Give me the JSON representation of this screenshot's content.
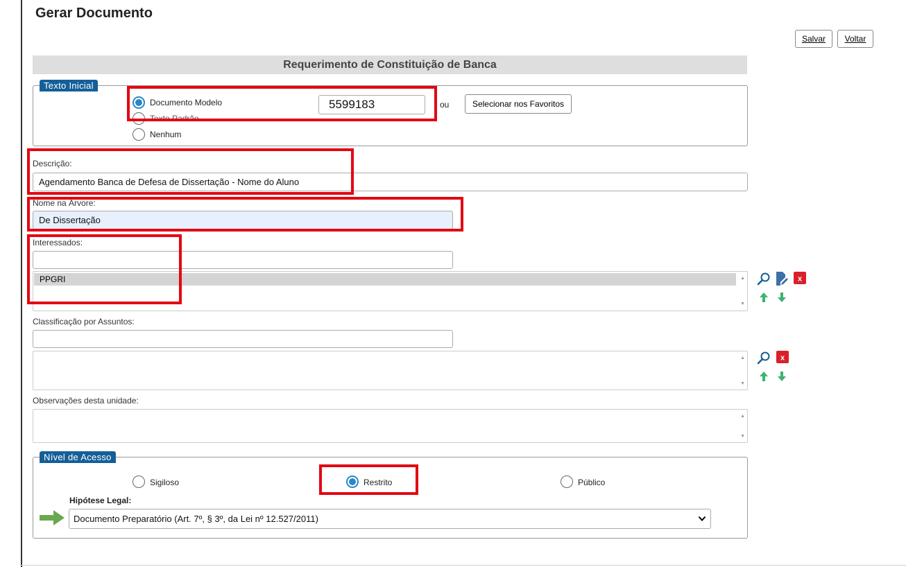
{
  "page": {
    "title": "Gerar Documento"
  },
  "toolbar": {
    "save_label": "Salvar",
    "back_label": "Voltar"
  },
  "form": {
    "header": "Requerimento de Constituição de Banca"
  },
  "texto_inicial": {
    "legend": "Texto Inicial",
    "options": [
      {
        "label": "Documento Modelo",
        "checked": true
      },
      {
        "label": "Texto Padrão",
        "checked": false
      },
      {
        "label": "Nenhum",
        "checked": false
      }
    ],
    "model_number": "5599183",
    "or_label": "ou",
    "favorites_button": "Selecionar nos Favoritos"
  },
  "descricao": {
    "label": "Descrição:",
    "value": "Agendamento Banca de Defesa de Dissertação - Nome do Aluno"
  },
  "nome_arvore": {
    "label": "Nome na Árvore:",
    "value": "De Dissertação"
  },
  "interessados": {
    "label": "Interessados:",
    "input_value": "",
    "items": [
      "PPGRI"
    ]
  },
  "classificacao": {
    "label": "Classificação por Assuntos:",
    "input_value": ""
  },
  "observacoes": {
    "label": "Observações desta unidade:",
    "value": ""
  },
  "nivel_acesso": {
    "legend": "Nível de Acesso",
    "options": [
      {
        "label": "Sigiloso",
        "checked": false
      },
      {
        "label": "Restrito",
        "checked": true
      },
      {
        "label": "Público",
        "checked": false
      }
    ],
    "hipotese_label": "Hipótese Legal:",
    "hipotese_value": "Documento Preparatório (Art. 7º, § 3º, da Lei nº 12.527/2011)"
  },
  "colors": {
    "accent_blue": "#155f98",
    "radio_blue": "#2a86c7",
    "highlight_red": "#e30613",
    "arrow_green": "#6aa84f",
    "action_green": "#3cb371"
  }
}
